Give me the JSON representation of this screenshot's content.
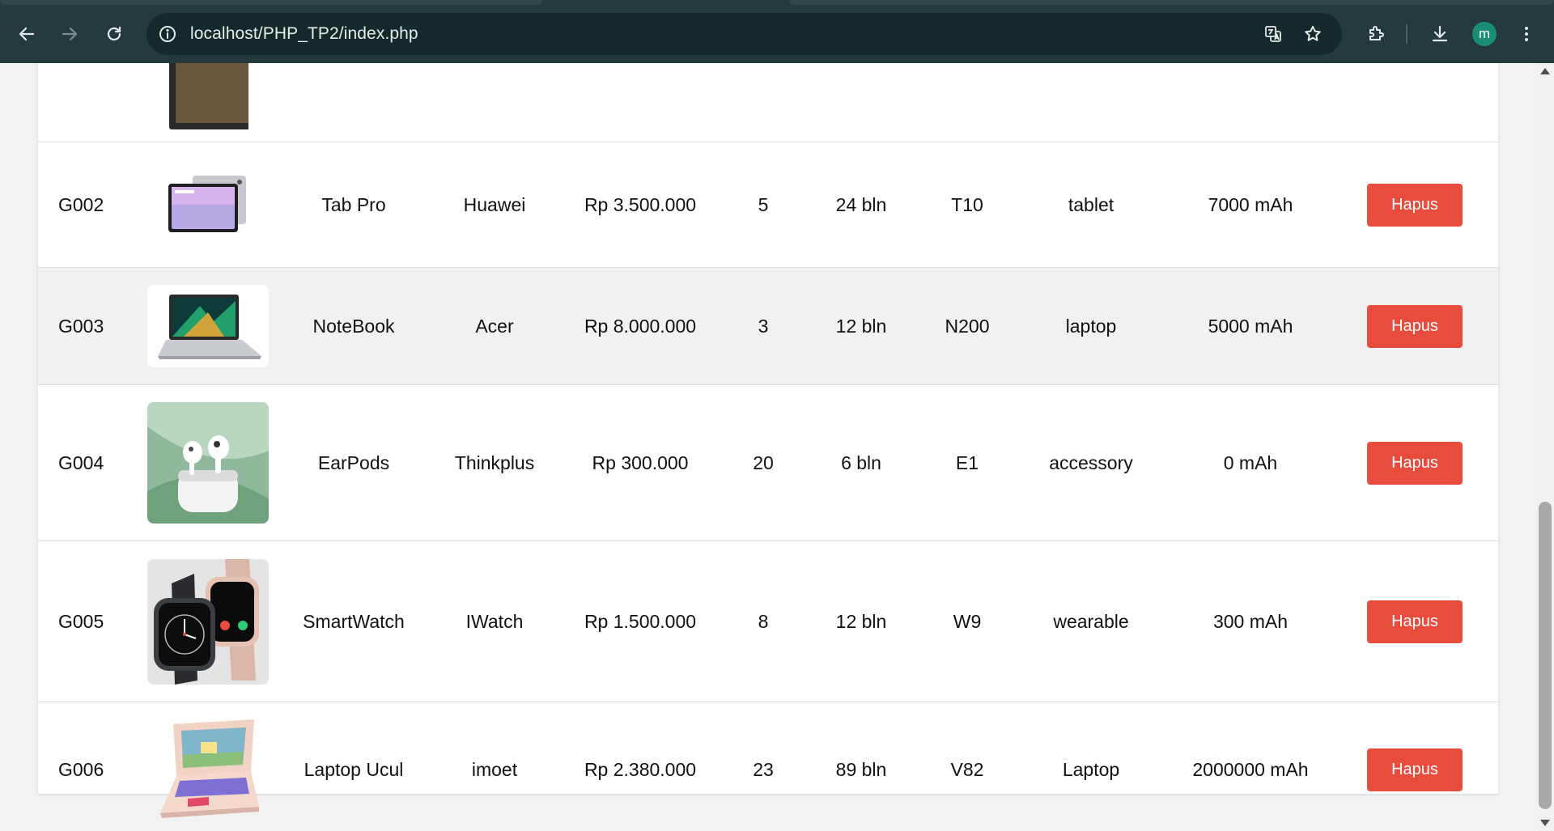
{
  "browser": {
    "url_host": "localhost",
    "url_path": "/PHP_TP2/index.php",
    "avatar_initial": "m",
    "icons": [
      "back-icon",
      "forward-icon",
      "reload-icon",
      "info-icon",
      "translate-icon",
      "star-icon",
      "extensions-icon",
      "download-icon",
      "menu-icon"
    ]
  },
  "table": {
    "rows": [
      {
        "code": "",
        "name": "",
        "brand": "",
        "price": "",
        "stock": "",
        "warranty": "",
        "model": "",
        "category": "",
        "battery": "",
        "action": ""
      },
      {
        "code": "G002",
        "name": "Tab Pro",
        "brand": "Huawei",
        "price": "Rp 3.500.000",
        "stock": "5",
        "warranty": "24 bln",
        "model": "T10",
        "category": "tablet",
        "battery": "7000 mAh",
        "action": "Hapus"
      },
      {
        "code": "G003",
        "name": "NoteBook",
        "brand": "Acer",
        "price": "Rp 8.000.000",
        "stock": "3",
        "warranty": "12 bln",
        "model": "N200",
        "category": "laptop",
        "battery": "5000 mAh",
        "action": "Hapus"
      },
      {
        "code": "G004",
        "name": "EarPods",
        "brand": "Thinkplus",
        "price": "Rp 300.000",
        "stock": "20",
        "warranty": "6 bln",
        "model": "E1",
        "category": "accessory",
        "battery": "0 mAh",
        "action": "Hapus"
      },
      {
        "code": "G005",
        "name": "SmartWatch",
        "brand": "IWatch",
        "price": "Rp 1.500.000",
        "stock": "8",
        "warranty": "12 bln",
        "model": "W9",
        "category": "wearable",
        "battery": "300 mAh",
        "action": "Hapus"
      },
      {
        "code": "G006",
        "name": "Laptop Ucul",
        "brand": "imoet",
        "price": "Rp 2.380.000",
        "stock": "23",
        "warranty": "89 bln",
        "model": "V82",
        "category": "Laptop",
        "battery": "2000000 mAh",
        "action": "Hapus"
      }
    ]
  },
  "colors": {
    "chrome_bg": "#243a3c",
    "omnibox_bg": "#15292b",
    "delete_button": "#e74c3c",
    "alt_row": "#f1f1f1",
    "avatar": "#1a8e74"
  }
}
